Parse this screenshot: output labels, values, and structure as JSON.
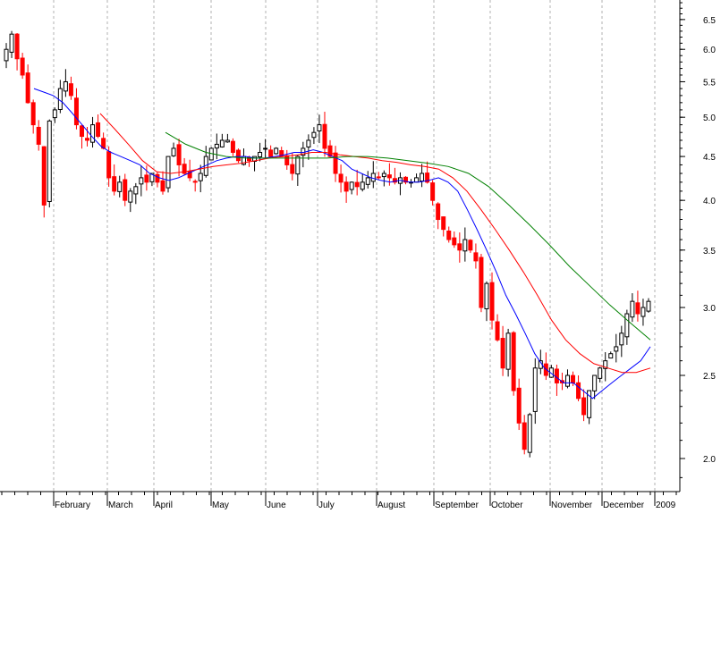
{
  "chart_data": {
    "type": "candlestick",
    "title": "",
    "xlabel": "",
    "ylabel": "",
    "y_scale": "log",
    "ylim": [
      1.83,
      6.85
    ],
    "y_ticks": [
      "2.0",
      "2.5",
      "3.0",
      "3.5",
      "4.0",
      "4.5",
      "5.0",
      "5.5",
      "6.0",
      "6.5"
    ],
    "x_ticks": [
      "February",
      "March",
      "April",
      "May",
      "June",
      "July",
      "August",
      "September",
      "October",
      "November",
      "December",
      "2009"
    ],
    "grid": "vertical dashed at month boundaries",
    "colors": {
      "up": "#000000",
      "down": "#ff0000",
      "ma_short": "#0000ff",
      "ma_mid": "#ff0000",
      "ma_long": "#008000"
    },
    "closes": [
      6.0,
      6.25,
      5.85,
      5.6,
      5.2,
      4.9,
      4.65,
      3.95,
      4.95,
      5.1,
      5.4,
      5.5,
      5.3,
      4.9,
      4.75,
      4.7,
      4.9,
      4.75,
      4.6,
      4.25,
      4.1,
      4.2,
      4.0,
      4.1,
      4.15,
      4.25,
      4.2,
      4.3,
      4.2,
      4.1,
      4.5,
      4.6,
      4.4,
      4.3,
      4.25,
      4.2,
      4.3,
      4.5,
      4.6,
      4.65,
      4.7,
      4.7,
      4.55,
      4.45,
      4.5,
      4.45,
      4.5,
      4.55,
      4.6,
      4.5,
      4.6,
      4.5,
      4.4,
      4.3,
      4.5,
      4.6,
      4.7,
      4.8,
      4.9,
      4.6,
      4.5,
      4.3,
      4.2,
      4.1,
      4.2,
      4.15,
      4.2,
      4.25,
      4.3,
      4.25,
      4.3,
      4.25,
      4.2,
      4.25,
      4.2,
      4.2,
      4.25,
      4.3,
      4.2,
      4.0,
      3.8,
      3.7,
      3.6,
      3.55,
      3.5,
      3.6,
      3.5,
      3.4,
      3.0,
      3.2,
      2.9,
      2.75,
      2.55,
      2.8,
      2.4,
      2.2,
      2.05,
      2.25,
      2.55,
      2.6,
      2.5,
      2.55,
      2.45,
      2.45,
      2.5,
      2.45,
      2.35,
      2.25,
      2.4,
      2.5,
      2.55,
      2.6,
      2.65,
      2.7,
      2.8,
      2.95,
      3.05,
      2.95,
      3.0,
      3.05
    ],
    "series": [
      {
        "values": [
          5.4,
          5.35,
          5.3,
          5.2,
          5.05,
          4.9,
          4.75,
          4.62,
          4.55,
          4.5,
          4.45,
          4.4,
          4.3,
          4.25,
          4.22,
          4.25,
          4.3,
          4.35,
          4.4,
          4.45,
          4.48,
          4.5,
          4.5,
          4.48,
          4.48,
          4.5,
          4.52,
          4.55,
          4.55,
          4.58,
          4.55,
          4.5,
          4.45,
          4.35,
          4.3,
          4.25,
          4.22,
          4.2,
          4.22,
          4.2,
          4.2,
          4.22,
          4.25,
          4.2,
          4.1,
          3.9,
          3.7,
          3.5,
          3.3,
          3.1,
          2.95,
          2.8,
          2.65,
          2.55,
          2.5,
          2.45,
          2.45,
          2.4,
          2.35,
          2.4,
          2.45,
          2.5,
          2.55,
          2.6,
          2.7
        ]
      },
      {
        "values": [
          5.05,
          4.85,
          4.65,
          4.45,
          4.32,
          4.3,
          4.32,
          4.35,
          4.38,
          4.4,
          4.42,
          4.45,
          4.48,
          4.5,
          4.52,
          4.55,
          4.55,
          4.52,
          4.5,
          4.48,
          4.45,
          4.43,
          4.4,
          4.38,
          4.35,
          4.25,
          4.1,
          3.9,
          3.7,
          3.5,
          3.3,
          3.1,
          2.9,
          2.75,
          2.65,
          2.58,
          2.55,
          2.52,
          2.52,
          2.55
        ]
      },
      {
        "values": [
          4.8,
          4.65,
          4.55,
          4.5,
          4.48,
          4.48,
          4.48,
          4.48,
          4.48,
          4.5,
          4.5,
          4.48,
          4.45,
          4.42,
          4.38,
          4.3,
          4.15,
          3.95,
          3.75,
          3.55,
          3.35,
          3.18,
          3.02,
          2.88,
          2.75
        ]
      }
    ]
  }
}
